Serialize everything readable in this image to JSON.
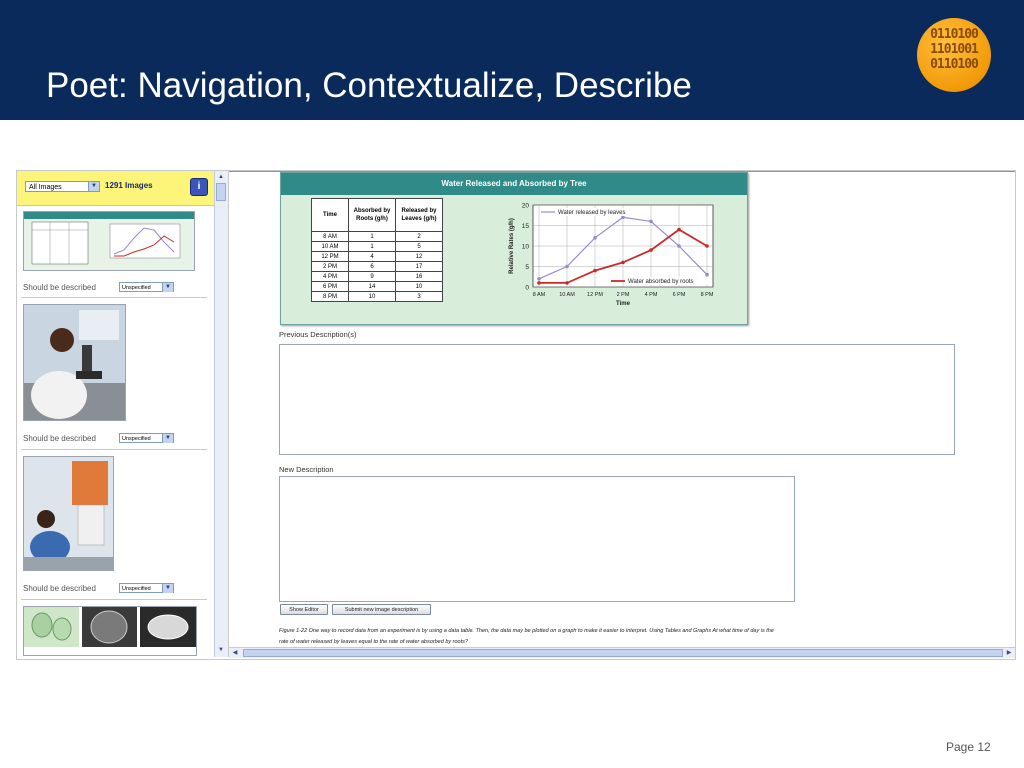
{
  "slide": {
    "title": "Poet: Navigation, Contextualize, Describe",
    "page_label": "Page 12",
    "logo_text": "0110100 1101001 0110100"
  },
  "colors": {
    "banner": "#0a2a5c",
    "toolbar_yellow": "#fdf57a",
    "figure_teal": "#2f8a88",
    "series_leaves": "#9a8ad0",
    "series_roots": "#cc2a2a"
  },
  "sidebar": {
    "filter_value": "All Images",
    "image_count": "1291 Images",
    "info_icon": "info-icon",
    "should_be_described_label": "Should be described",
    "status_options_selected": "Unspecified",
    "thumbnails": [
      "chart-thumbnail",
      "scientist-microscope-photo",
      "lab-technician-photo",
      "cell-micrographs"
    ]
  },
  "main": {
    "figure": {
      "title": "Water Released and Absorbed by Tree",
      "table_headers": [
        "Time",
        "Absorbed by Roots (g/h)",
        "Released by Leaves (g/h)"
      ],
      "table_rows": [
        [
          "8 AM",
          "1",
          "2"
        ],
        [
          "10 AM",
          "1",
          "5"
        ],
        [
          "12 PM",
          "4",
          "12"
        ],
        [
          "2 PM",
          "6",
          "17"
        ],
        [
          "4 PM",
          "9",
          "16"
        ],
        [
          "6 PM",
          "14",
          "10"
        ],
        [
          "8 PM",
          "10",
          "3"
        ]
      ]
    },
    "previous_label": "Previous Description(s)",
    "new_label": "New Description",
    "show_editor_label": "Show Editor",
    "submit_label": "Submit new image description",
    "caption_line1": "Figure 1-22 One way to record data from an experiment is by using a data table. Then, the data may be plotted on a graph to make it easier to interpret. Using Tables and Graphs At what time of day is the",
    "caption_line2": "rate of water released by leaves equal to the rate of water absorbed by roots?"
  },
  "chart_data": {
    "type": "line",
    "x": [
      "8 AM",
      "10 AM",
      "12 PM",
      "2 PM",
      "4 PM",
      "6 PM",
      "8 PM"
    ],
    "series": [
      {
        "name": "Water released by leaves",
        "values": [
          2,
          5,
          12,
          17,
          16,
          10,
          3
        ],
        "color": "#9a8ad0"
      },
      {
        "name": "Water absorbed by roots",
        "values": [
          1,
          1,
          4,
          6,
          9,
          14,
          10
        ],
        "color": "#cc2a2a"
      }
    ],
    "xlabel": "Time",
    "ylabel": "Relative Rates (g/h)",
    "ylim": [
      0,
      20
    ],
    "yticks": [
      0,
      5,
      10,
      15,
      20
    ],
    "grid": true
  }
}
